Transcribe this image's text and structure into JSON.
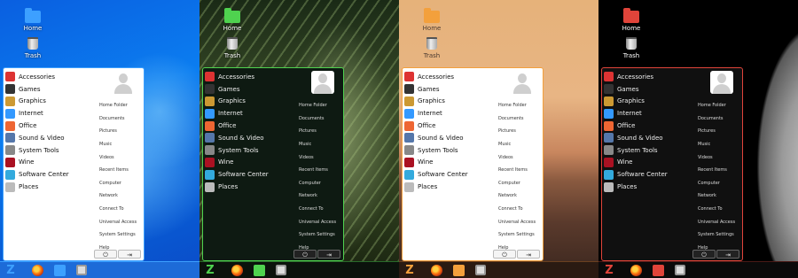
{
  "themes": [
    {
      "accent": "#3da0ff",
      "wallpaper": "blue-particles"
    },
    {
      "accent": "#4fd24f",
      "wallpaper": "pine-needles"
    },
    {
      "accent": "#f3a03c",
      "wallpaper": "sunset-hills"
    },
    {
      "accent": "#e0443a",
      "wallpaper": "moon"
    }
  ],
  "desktop": {
    "home_label": "Home",
    "trash_label": "Trash"
  },
  "menu": {
    "categories": [
      {
        "label": "Accessories",
        "icon": "accessories-icon",
        "color": "#d33"
      },
      {
        "label": "Games",
        "icon": "games-icon",
        "color": "#333"
      },
      {
        "label": "Graphics",
        "icon": "graphics-icon",
        "color": "#c93"
      },
      {
        "label": "Internet",
        "icon": "internet-icon",
        "color": "#39f"
      },
      {
        "label": "Office",
        "icon": "office-icon",
        "color": "#e63"
      },
      {
        "label": "Sound & Video",
        "icon": "sound-video-icon",
        "color": "#57a"
      },
      {
        "label": "System Tools",
        "icon": "system-tools-icon",
        "color": "#888"
      },
      {
        "label": "Wine",
        "icon": "wine-icon",
        "color": "#a12"
      },
      {
        "label": "Software Center",
        "icon": "software-center-icon",
        "color": "#3ad"
      },
      {
        "label": "Places",
        "icon": "places-icon",
        "color": "#bbb"
      }
    ],
    "places": [
      "Home Folder",
      "Documents",
      "Pictures",
      "Music",
      "Videos",
      "Recent Items",
      "Computer",
      "Network",
      "Connect To",
      "Universal Access",
      "System Settings",
      "Help"
    ],
    "power_icon": "power-icon",
    "logout_icon": "logout-icon",
    "power_glyph": "⏻",
    "logout_glyph": "⇥"
  },
  "taskbar": {
    "logo_text": "Z",
    "apps": [
      "firefox-icon",
      "home-folder-icon",
      "software-center-icon"
    ]
  }
}
